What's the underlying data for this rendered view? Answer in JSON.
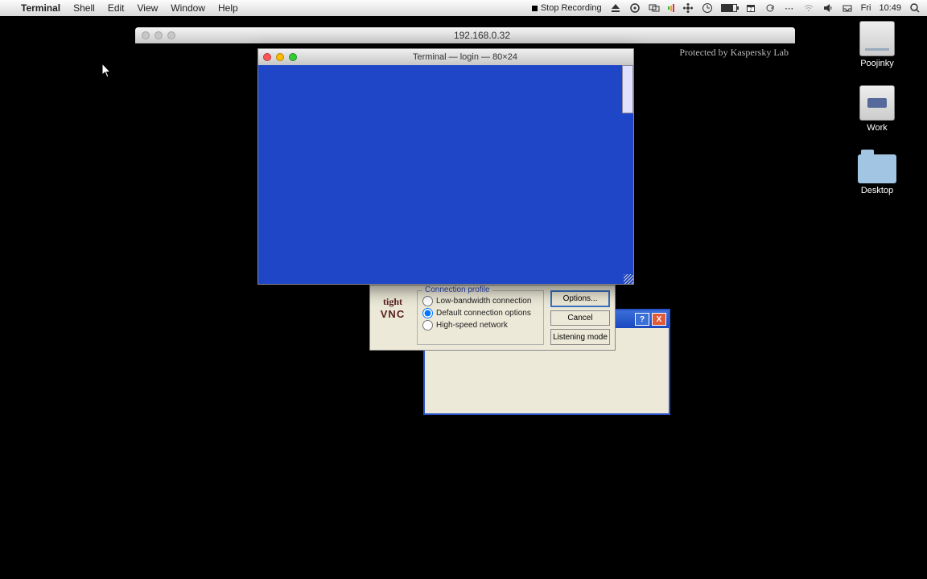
{
  "menubar": {
    "appname": "Terminal",
    "items": [
      "Shell",
      "Edit",
      "View",
      "Window",
      "Help"
    ],
    "stop_recording": "Stop Recording",
    "day": "Fri",
    "time": "10:49"
  },
  "vnc_window": {
    "title": "192.168.0.32",
    "watermark": "Protected by Kaspersky Lab"
  },
  "terminal": {
    "title": "Terminal — login — 80×24"
  },
  "desktop": {
    "icons": [
      {
        "name": "Poojinky",
        "kind": "hd"
      },
      {
        "name": "Work",
        "kind": "server"
      },
      {
        "name": "Desktop",
        "kind": "folder"
      }
    ]
  },
  "vnc_dialog": {
    "logo_top": "tight",
    "logo_bottom": "VNC",
    "group_label": "Connection profile",
    "options": [
      {
        "label": "Low-bandwidth connection",
        "checked": false
      },
      {
        "label": "Default connection options",
        "checked": true
      },
      {
        "label": "High-speed network",
        "checked": false
      }
    ],
    "buttons": {
      "options": "Options...",
      "cancel": "Cancel",
      "listening": "Listening mode"
    }
  },
  "xp_window": {
    "help": "?",
    "close": "X"
  }
}
